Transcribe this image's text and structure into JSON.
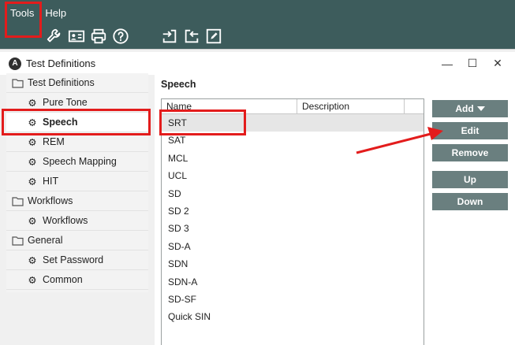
{
  "menubar": {
    "tools": "Tools",
    "help": "Help"
  },
  "toolbar": {
    "left_icons": [
      "wrench-icon",
      "id-card-icon",
      "printer-icon",
      "help-icon"
    ],
    "right_icons": [
      "import-icon",
      "export-icon",
      "edit-icon"
    ]
  },
  "dialog": {
    "title": "Test Definitions",
    "title_icon_letter": "A",
    "controls": {
      "minimize": "—",
      "maximize": "☐",
      "close": "✕"
    }
  },
  "tree": {
    "groups": [
      {
        "label": "Test Definitions",
        "items": [
          "Pure Tone",
          "Speech",
          "REM",
          "Speech Mapping",
          "HIT"
        ]
      },
      {
        "label": "Workflows",
        "items": [
          "Workflows"
        ]
      },
      {
        "label": "General",
        "items": [
          "Set Password",
          "Common"
        ]
      }
    ],
    "selected": "Speech"
  },
  "content": {
    "section_title": "Speech",
    "columns": {
      "name": "Name",
      "description": "Description"
    },
    "rows": [
      "SRT",
      "SAT",
      "MCL",
      "UCL",
      "SD",
      "SD 2",
      "SD 3",
      "SD-A",
      "SDN",
      "SDN-A",
      "SD-SF",
      "Quick SIN"
    ],
    "selected_row": "SRT"
  },
  "buttons": {
    "add": "Add",
    "edit": "Edit",
    "remove": "Remove",
    "up": "Up",
    "down": "Down"
  },
  "colors": {
    "app_bar": "#3d5c5c",
    "button": "#6a7f7f",
    "highlight": "#e31c1c"
  }
}
